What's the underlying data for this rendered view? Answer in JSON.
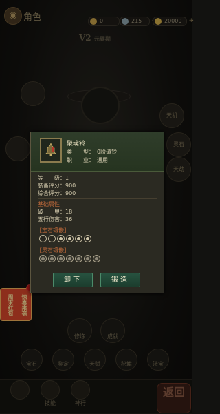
{
  "header": {
    "back_icon": "lantern-icon",
    "title": "角色",
    "resources": [
      {
        "value": "0",
        "icon": "coin-icon",
        "color": "#c9a44a"
      },
      {
        "value": "215",
        "icon": "jade-icon",
        "color": "#8fa7b0"
      },
      {
        "value": "20000",
        "icon": "gold-icon",
        "color": "#d4b04a"
      }
    ]
  },
  "vip": {
    "level": "V2",
    "name": "元婴期"
  },
  "side_buttons": {
    "right": [
      "天机",
      "灵石",
      "天劫"
    ]
  },
  "item": {
    "name": "聚魂铃",
    "type_label": "类　　型：",
    "type_value": "0阶道铃",
    "job_label": "职　　业：",
    "job_value": "通用",
    "level_label": "等　　级：",
    "level_value": "1",
    "equip_score_label": "装备评分：",
    "equip_score_value": "900",
    "total_score_label": "综合评分：",
    "total_score_value": "900"
  },
  "base_attr": {
    "title": "基础属性",
    "pierce_label": "破　　甲：",
    "pierce_value": "18",
    "elem_label": "五行伤害：",
    "elem_value": "36"
  },
  "gem_inlay": {
    "title": "【宝石镶嵌】",
    "slots": [
      false,
      false,
      true,
      true,
      true,
      true
    ]
  },
  "spirit_inlay": {
    "title": "【灵石镶嵌】",
    "slots": 7
  },
  "buttons": {
    "unequip": "卸下",
    "forge": "锻造"
  },
  "bottom_row1": [
    "修炼",
    "成就"
  ],
  "bottom_row2": [
    "宝石",
    "鉴定",
    "天赋",
    "秘籍",
    "法宝"
  ],
  "nav": [
    "",
    "技能",
    "神行"
  ],
  "back_button": {
    "label": "返回"
  },
  "event_badge": {
    "left": "周末红包",
    "right": "惊喜来袭"
  }
}
